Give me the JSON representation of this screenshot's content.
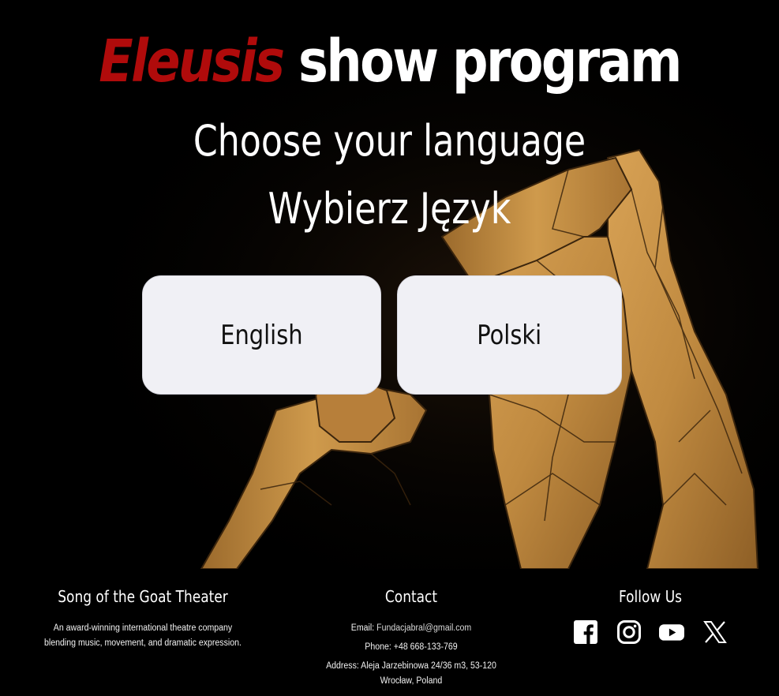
{
  "hero": {
    "title_brand": "Eleusis",
    "title_rest": " show program",
    "subtitle_en": "Choose your language",
    "subtitle_pl": "Wybierz Język",
    "buttons": {
      "english": "English",
      "polski": "Polski"
    }
  },
  "footer": {
    "about": {
      "heading": "Song of the Goat Theater",
      "text": "An award-winning international theatre company blending music, movement, and dramatic expression."
    },
    "contact": {
      "heading": "Contact",
      "email_label": "Email: ",
      "email": "Fundacjabral@gmail.com",
      "phone": "Phone: +48 668-133-769",
      "address": "Address: Aleja Jarzebinowa 24/36 m3, 53-120 Wrocław, Poland"
    },
    "follow": {
      "heading": "Follow Us",
      "icons": [
        "facebook-icon",
        "instagram-icon",
        "youtube-icon",
        "x-icon"
      ]
    }
  },
  "colors": {
    "brand_red": "#b00b0b",
    "background": "#000000",
    "button_bg": "#f0f0f5",
    "sculpture": "#c8903f"
  }
}
